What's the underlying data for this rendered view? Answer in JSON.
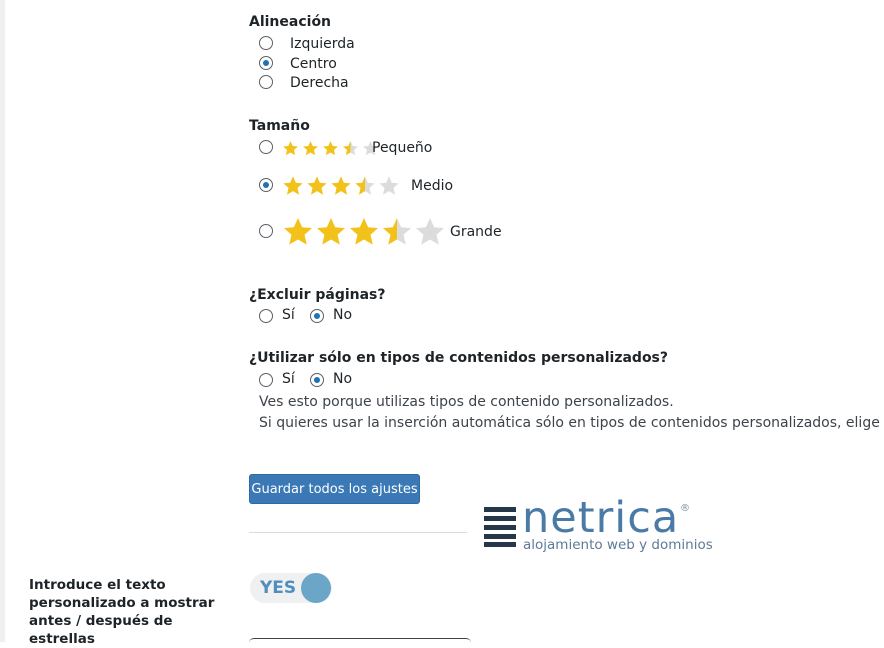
{
  "alignment": {
    "heading": "Alineación",
    "options": [
      {
        "label": "Izquierda",
        "checked": false
      },
      {
        "label": "Centro",
        "checked": true
      },
      {
        "label": "Derecha",
        "checked": false
      }
    ]
  },
  "size": {
    "heading": "Tamaño",
    "rating_value": 3.5,
    "rating_max": 5,
    "star_colors": {
      "filled": "#f2c21a",
      "empty": "#dcdcdc"
    },
    "options": [
      {
        "label": "Pequeño",
        "checked": false
      },
      {
        "label": "Medio",
        "checked": true
      },
      {
        "label": "Grande",
        "checked": false
      }
    ]
  },
  "exclude_pages": {
    "heading": "¿Excluir páginas?",
    "options": [
      {
        "label": "Sí",
        "checked": false
      },
      {
        "label": "No",
        "checked": true
      }
    ]
  },
  "custom_types": {
    "heading": "¿Utilizar sólo en tipos de contenidos personalizados?",
    "options": [
      {
        "label": "Sí",
        "checked": false
      },
      {
        "label": "No",
        "checked": true
      }
    ],
    "help_line_1": "Ves esto porque utilizas tipos de contenido personalizados.",
    "help_line_2": "Si quieres usar la inserción automática sólo en tipos de contenidos personalizados, elige SÍ"
  },
  "save_button": {
    "label": "Guardar todos los ajustes",
    "color": "#3a79b6"
  },
  "logo": {
    "name": "netrica",
    "registered_mark": "®",
    "tagline": "alojamiento web y dominios"
  },
  "custom_text": {
    "label": "Introduce el texto personalizado a mostrar antes / después de estrellas",
    "toggle_text": "YES",
    "toggle_on": true
  }
}
